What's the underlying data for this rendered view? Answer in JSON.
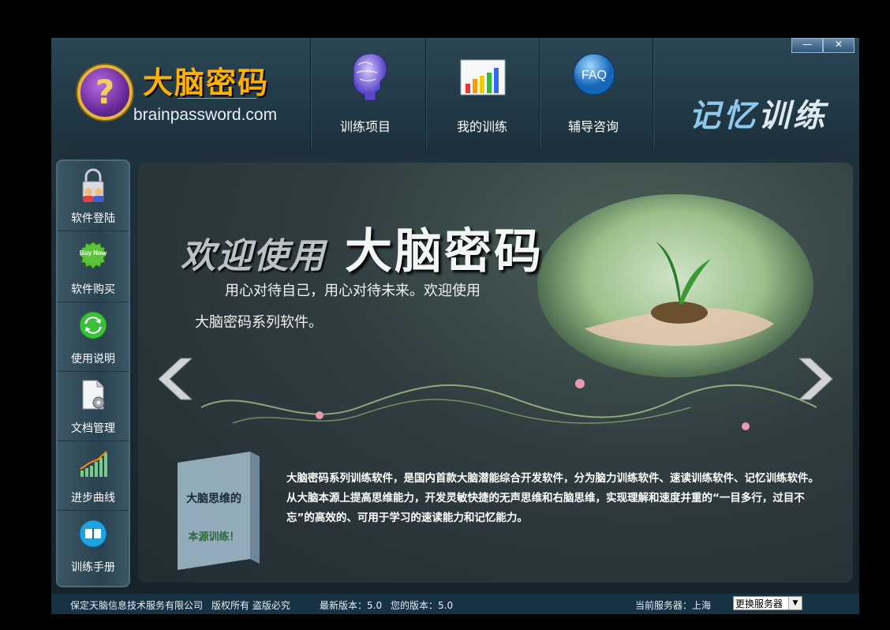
{
  "header": {
    "brand_title": "大脑密码",
    "brand_url": "brainpassword.com",
    "logo_glyph": "?",
    "nav": [
      {
        "label": "训练项目",
        "icon": "brain-icon"
      },
      {
        "label": "我的训练",
        "icon": "bar-chart-icon"
      },
      {
        "label": "辅导咨询",
        "icon": "faq-icon",
        "icon_text": "FAQ"
      }
    ],
    "module_title_a": "记忆",
    "module_title_b": "训练",
    "window_minimize": "—",
    "window_close": "✕"
  },
  "sidebar": {
    "items": [
      {
        "label": "软件登陆",
        "icon": "lock-user-icon"
      },
      {
        "label": "软件购买",
        "icon": "buy-now-icon",
        "icon_text": "Buy Now"
      },
      {
        "label": "使用说明",
        "icon": "refresh-icon"
      },
      {
        "label": "文档管理",
        "icon": "document-gear-icon"
      },
      {
        "label": "进步曲线",
        "icon": "progress-chart-icon"
      },
      {
        "label": "训练手册",
        "icon": "book-icon"
      }
    ]
  },
  "banner": {
    "welcome_prefix": "欢迎使用",
    "welcome_brand": "大脑密码",
    "slogan_line1": "用心对待自己，用心对待未来。欢迎使用",
    "slogan_line2": "大脑密码系列软件。",
    "box_title": "大脑思维的",
    "box_subtitle": "本源训练！",
    "description": "大脑密码系列训练软件，是国内首款大脑潜能综合开发软件，分为脑力训练软件、速读训练软件、记忆训练软件。从大脑本源上提高思维能力，开发灵敏快捷的无声思维和右脑思维，实现理解和速度并重的“一目多行，过目不忘”的高效的、可用于学习的速读能力和记忆能力。"
  },
  "footer": {
    "company": "保定天脑信息技术服务有限公司",
    "rights": "版权所有 盗版必究",
    "latest_version": "最新版本：5.0",
    "your_version": "您的版本：5.0",
    "server_label": "当前服务器：上海",
    "server_select": "更换服务器"
  },
  "colors": {
    "brand_orange": "#ffb000",
    "header_bg": "#2b4655",
    "footer_bg": "#173243",
    "logo_purple": "#6a2a9a",
    "logo_gold": "#e2b63a"
  }
}
